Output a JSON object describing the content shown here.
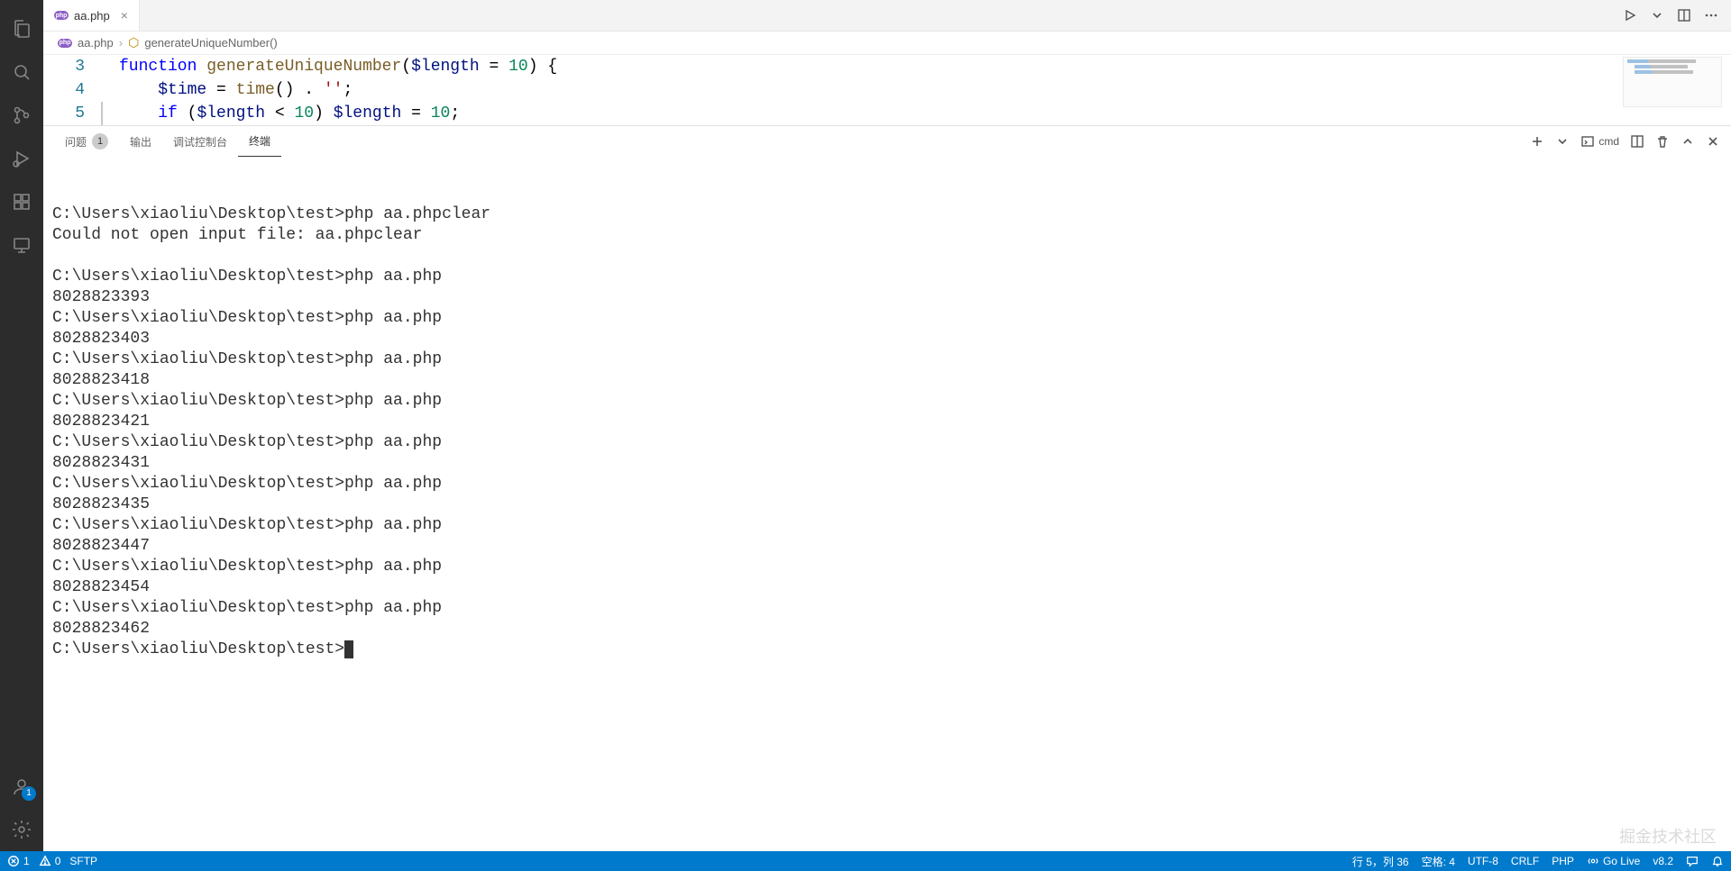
{
  "tab": {
    "filename": "aa.php"
  },
  "breadcrumb": {
    "file": "aa.php",
    "symbol": "generateUniqueNumber()"
  },
  "editor": {
    "lines": [
      {
        "num": "3",
        "tokens": [
          {
            "t": "kw",
            "v": "function"
          },
          {
            "t": "op",
            "v": " "
          },
          {
            "t": "fn",
            "v": "generateUniqueNumber"
          },
          {
            "t": "op",
            "v": "("
          },
          {
            "t": "var",
            "v": "$length"
          },
          {
            "t": "op",
            "v": " = "
          },
          {
            "t": "num",
            "v": "10"
          },
          {
            "t": "op",
            "v": ") {"
          }
        ]
      },
      {
        "num": "4",
        "tokens": [
          {
            "t": "op",
            "v": "    "
          },
          {
            "t": "var",
            "v": "$time"
          },
          {
            "t": "op",
            "v": " = "
          },
          {
            "t": "fn",
            "v": "time"
          },
          {
            "t": "op",
            "v": "() . "
          },
          {
            "t": "str",
            "v": "''"
          },
          {
            "t": "op",
            "v": ";"
          }
        ]
      },
      {
        "num": "5",
        "tokens": [
          {
            "t": "op",
            "v": "    "
          },
          {
            "t": "kw",
            "v": "if"
          },
          {
            "t": "op",
            "v": " ("
          },
          {
            "t": "var",
            "v": "$length"
          },
          {
            "t": "op",
            "v": " < "
          },
          {
            "t": "num",
            "v": "10"
          },
          {
            "t": "op",
            "v": ") "
          },
          {
            "t": "var",
            "v": "$length"
          },
          {
            "t": "op",
            "v": " = "
          },
          {
            "t": "num",
            "v": "10"
          },
          {
            "t": "op",
            "v": ";"
          }
        ]
      }
    ]
  },
  "panel": {
    "tabs": {
      "problems": "问题",
      "problems_count": "1",
      "output": "输出",
      "debug": "调试控制台",
      "terminal": "终端"
    },
    "shell": "cmd"
  },
  "terminal": {
    "prompt": "C:\\Users\\xiaoliu\\Desktop\\test>",
    "runs": [
      {
        "cmd": "php aa.phpclear",
        "out": "Could not open input file: aa.phpclear",
        "blank_after": true
      },
      {
        "cmd": "php aa.php",
        "out": "8028823393"
      },
      {
        "cmd": "php aa.php",
        "out": "8028823403"
      },
      {
        "cmd": "php aa.php",
        "out": "8028823418"
      },
      {
        "cmd": "php aa.php",
        "out": "8028823421"
      },
      {
        "cmd": "php aa.php",
        "out": "8028823431"
      },
      {
        "cmd": "php aa.php",
        "out": "8028823435"
      },
      {
        "cmd": "php aa.php",
        "out": "8028823447"
      },
      {
        "cmd": "php aa.php",
        "out": "8028823454"
      },
      {
        "cmd": "php aa.php",
        "out": "8028823462"
      }
    ]
  },
  "status": {
    "errors": "1",
    "warnings": "0",
    "sftp": "SFTP",
    "line_col": "行 5，列 36",
    "spaces": "空格: 4",
    "encoding": "UTF-8",
    "eol": "CRLF",
    "lang": "PHP",
    "golive": "Go Live",
    "version": "v8.2"
  },
  "account_badge": "1",
  "watermark": "掘金技术社区"
}
